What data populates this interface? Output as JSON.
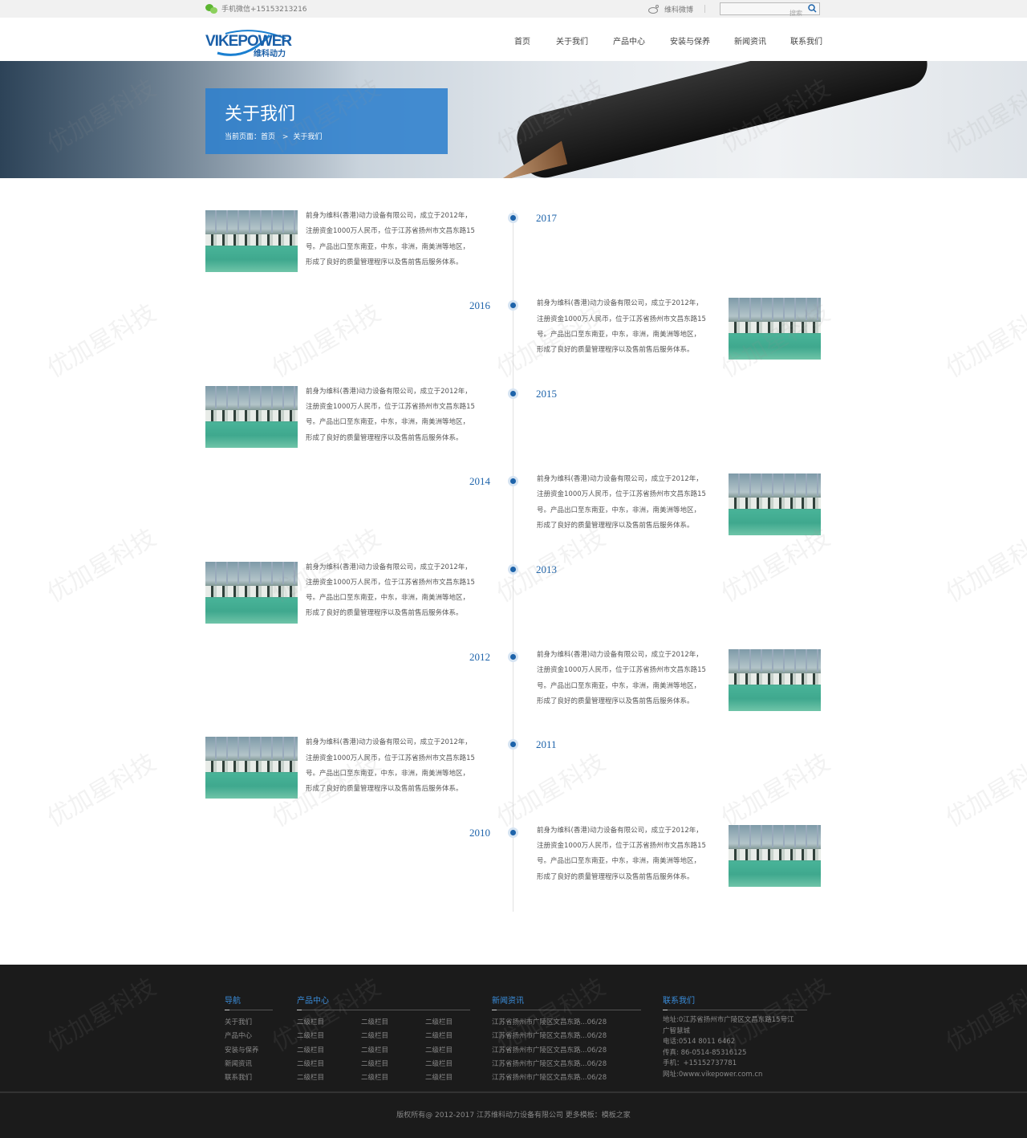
{
  "topbar": {
    "wechat": "手机微信+15153213216",
    "weibo": "维科微博",
    "search_placeholder": "搜索"
  },
  "logo": {
    "text": "VIKEPOWER",
    "cn": "维科动力"
  },
  "nav": [
    "首页",
    "关于我们",
    "产品中心",
    "安装与保养",
    "新闻资讯",
    "联系我们"
  ],
  "banner": {
    "title": "关于我们",
    "breadcrumb_prefix": "当前页面：",
    "breadcrumb_home": "首页",
    "breadcrumb_sep": ">",
    "breadcrumb_current": "关于我们"
  },
  "timeline": [
    {
      "year": "2017",
      "side": "left",
      "lines": [
        "前身为维科(香港)动力设备有限公司，成立于2012年，",
        "注册资金1000万人民币，位于江苏省扬州市文昌东路15",
        "号。产品出口至东南亚，中东，非洲，南美洲等地区，",
        "形成了良好的质量管理程序以及售前售后服务体系。"
      ]
    },
    {
      "year": "2016",
      "side": "right",
      "lines": [
        "前身为维科(香港)动力设备有限公司，成立于2012年，",
        "注册资金1000万人民币，位于江苏省扬州市文昌东路15",
        "号。产品出口至东南亚，中东，非洲，南美洲等地区，",
        "形成了良好的质量管理程序以及售前售后服务体系。"
      ]
    },
    {
      "year": "2015",
      "side": "left",
      "lines": [
        "前身为维科(香港)动力设备有限公司，成立于2012年，",
        "注册资金1000万人民币，位于江苏省扬州市文昌东路15",
        "号。产品出口至东南亚，中东，非洲，南美洲等地区，",
        "形成了良好的质量管理程序以及售前售后服务体系。"
      ]
    },
    {
      "year": "2014",
      "side": "right",
      "lines": [
        "前身为维科(香港)动力设备有限公司，成立于2012年，",
        "注册资金1000万人民币，位于江苏省扬州市文昌东路15",
        "号。产品出口至东南亚，中东，非洲，南美洲等地区，",
        "形成了良好的质量管理程序以及售前售后服务体系。"
      ]
    },
    {
      "year": "2013",
      "side": "left",
      "lines": [
        "前身为维科(香港)动力设备有限公司，成立于2012年，",
        "注册资金1000万人民币，位于江苏省扬州市文昌东路15",
        "号。产品出口至东南亚，中东，非洲，南美洲等地区，",
        "形成了良好的质量管理程序以及售前售后服务体系。"
      ]
    },
    {
      "year": "2012",
      "side": "right",
      "lines": [
        "前身为维科(香港)动力设备有限公司，成立于2012年，",
        "注册资金1000万人民币，位于江苏省扬州市文昌东路15",
        "号。产品出口至东南亚，中东，非洲，南美洲等地区，",
        "形成了良好的质量管理程序以及售前售后服务体系。"
      ]
    },
    {
      "year": "2011",
      "side": "left",
      "lines": [
        "前身为维科(香港)动力设备有限公司，成立于2012年，",
        "注册资金1000万人民币，位于江苏省扬州市文昌东路15",
        "号。产品出口至东南亚，中东，非洲，南美洲等地区，",
        "形成了良好的质量管理程序以及售前售后服务体系。"
      ]
    },
    {
      "year": "2010",
      "side": "right",
      "lines": [
        "前身为维科(香港)动力设备有限公司，成立于2012年，",
        "注册资金1000万人民币，位于江苏省扬州市文昌东路15",
        "号。产品出口至东南亚，中东，非洲，南美洲等地区，",
        "形成了良好的质量管理程序以及售前售后服务体系。"
      ]
    }
  ],
  "footer": {
    "nav_title": "导航",
    "nav_items": [
      "关于我们",
      "产品中心",
      "安装与保养",
      "新闻资讯",
      "联系我们"
    ],
    "products_title": "产品中心",
    "product_items": [
      "二级栏目",
      "二级栏目",
      "二级栏目",
      "二级栏目",
      "二级栏目"
    ],
    "news_title": "新闻资讯",
    "news_items": [
      "江苏省扬州市广陵区文昌东路...06/28",
      "江苏省扬州市广陵区文昌东路...06/28",
      "江苏省扬州市广陵区文昌东路...06/28",
      "江苏省扬州市广陵区文昌东路...06/28",
      "江苏省扬州市广陵区文昌东路...06/28"
    ],
    "contact_title": "联系我们",
    "contact_lines": [
      "地址:0江苏省扬州市广陵区文昌东路15号江",
      "广智慧城",
      "电话:0514 8011 6462",
      "传真: 86-0514-85316125",
      "手机：+15152737781",
      "网址:0www.vikepower.com.cn"
    ],
    "copyright": "版权所有@ 2012-2017 江苏维科动力设备有限公司 更多模板：模板之家"
  },
  "watermark": "优加星科技",
  "colors": {
    "accent": "#1d63aa",
    "banner_box": "#2e80cd",
    "footer_bg": "#1b1b1b",
    "footer_heading": "#3a8ddb"
  }
}
